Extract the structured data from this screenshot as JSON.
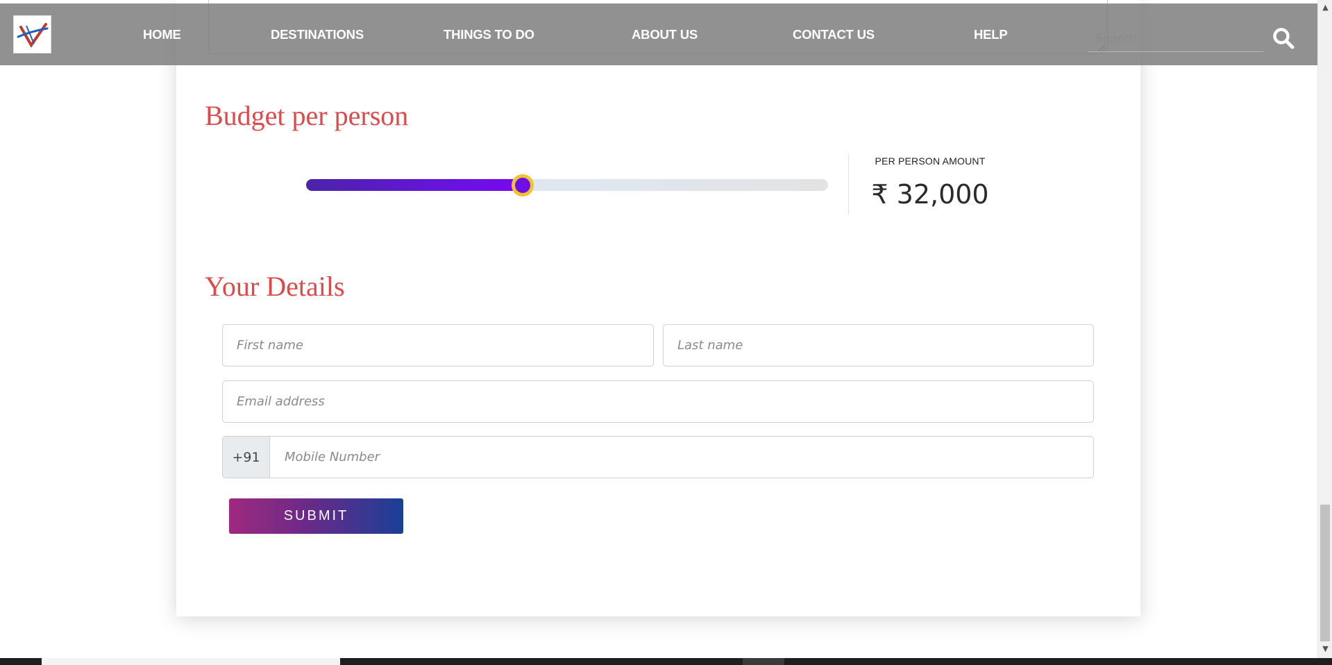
{
  "header": {
    "nav": [
      "HOME",
      "DESTINATIONS",
      "THINGS TO DO",
      "ABOUT US",
      "CONTACT US",
      "HELP"
    ],
    "search_placeholder": "Search"
  },
  "budget": {
    "title": "Budget per person",
    "amount_label": "PER PERSON AMOUNT",
    "amount_value": "₹ 32,000",
    "slider_level": 0.415
  },
  "details": {
    "title": "Your Details",
    "first_name_placeholder": "First name",
    "last_name_placeholder": "Last name",
    "email_placeholder": "Email address",
    "phone_prefix": "+91",
    "mobile_placeholder": "Mobile Number",
    "submit_label": "SUBMIT"
  },
  "colors": {
    "heading": "#dc4a4a",
    "slider_fill": "#6a12e0",
    "slider_thumb_ring": "#f1c232",
    "submit_gradient_start": "#a0297e",
    "submit_gradient_end": "#1a3f97"
  }
}
